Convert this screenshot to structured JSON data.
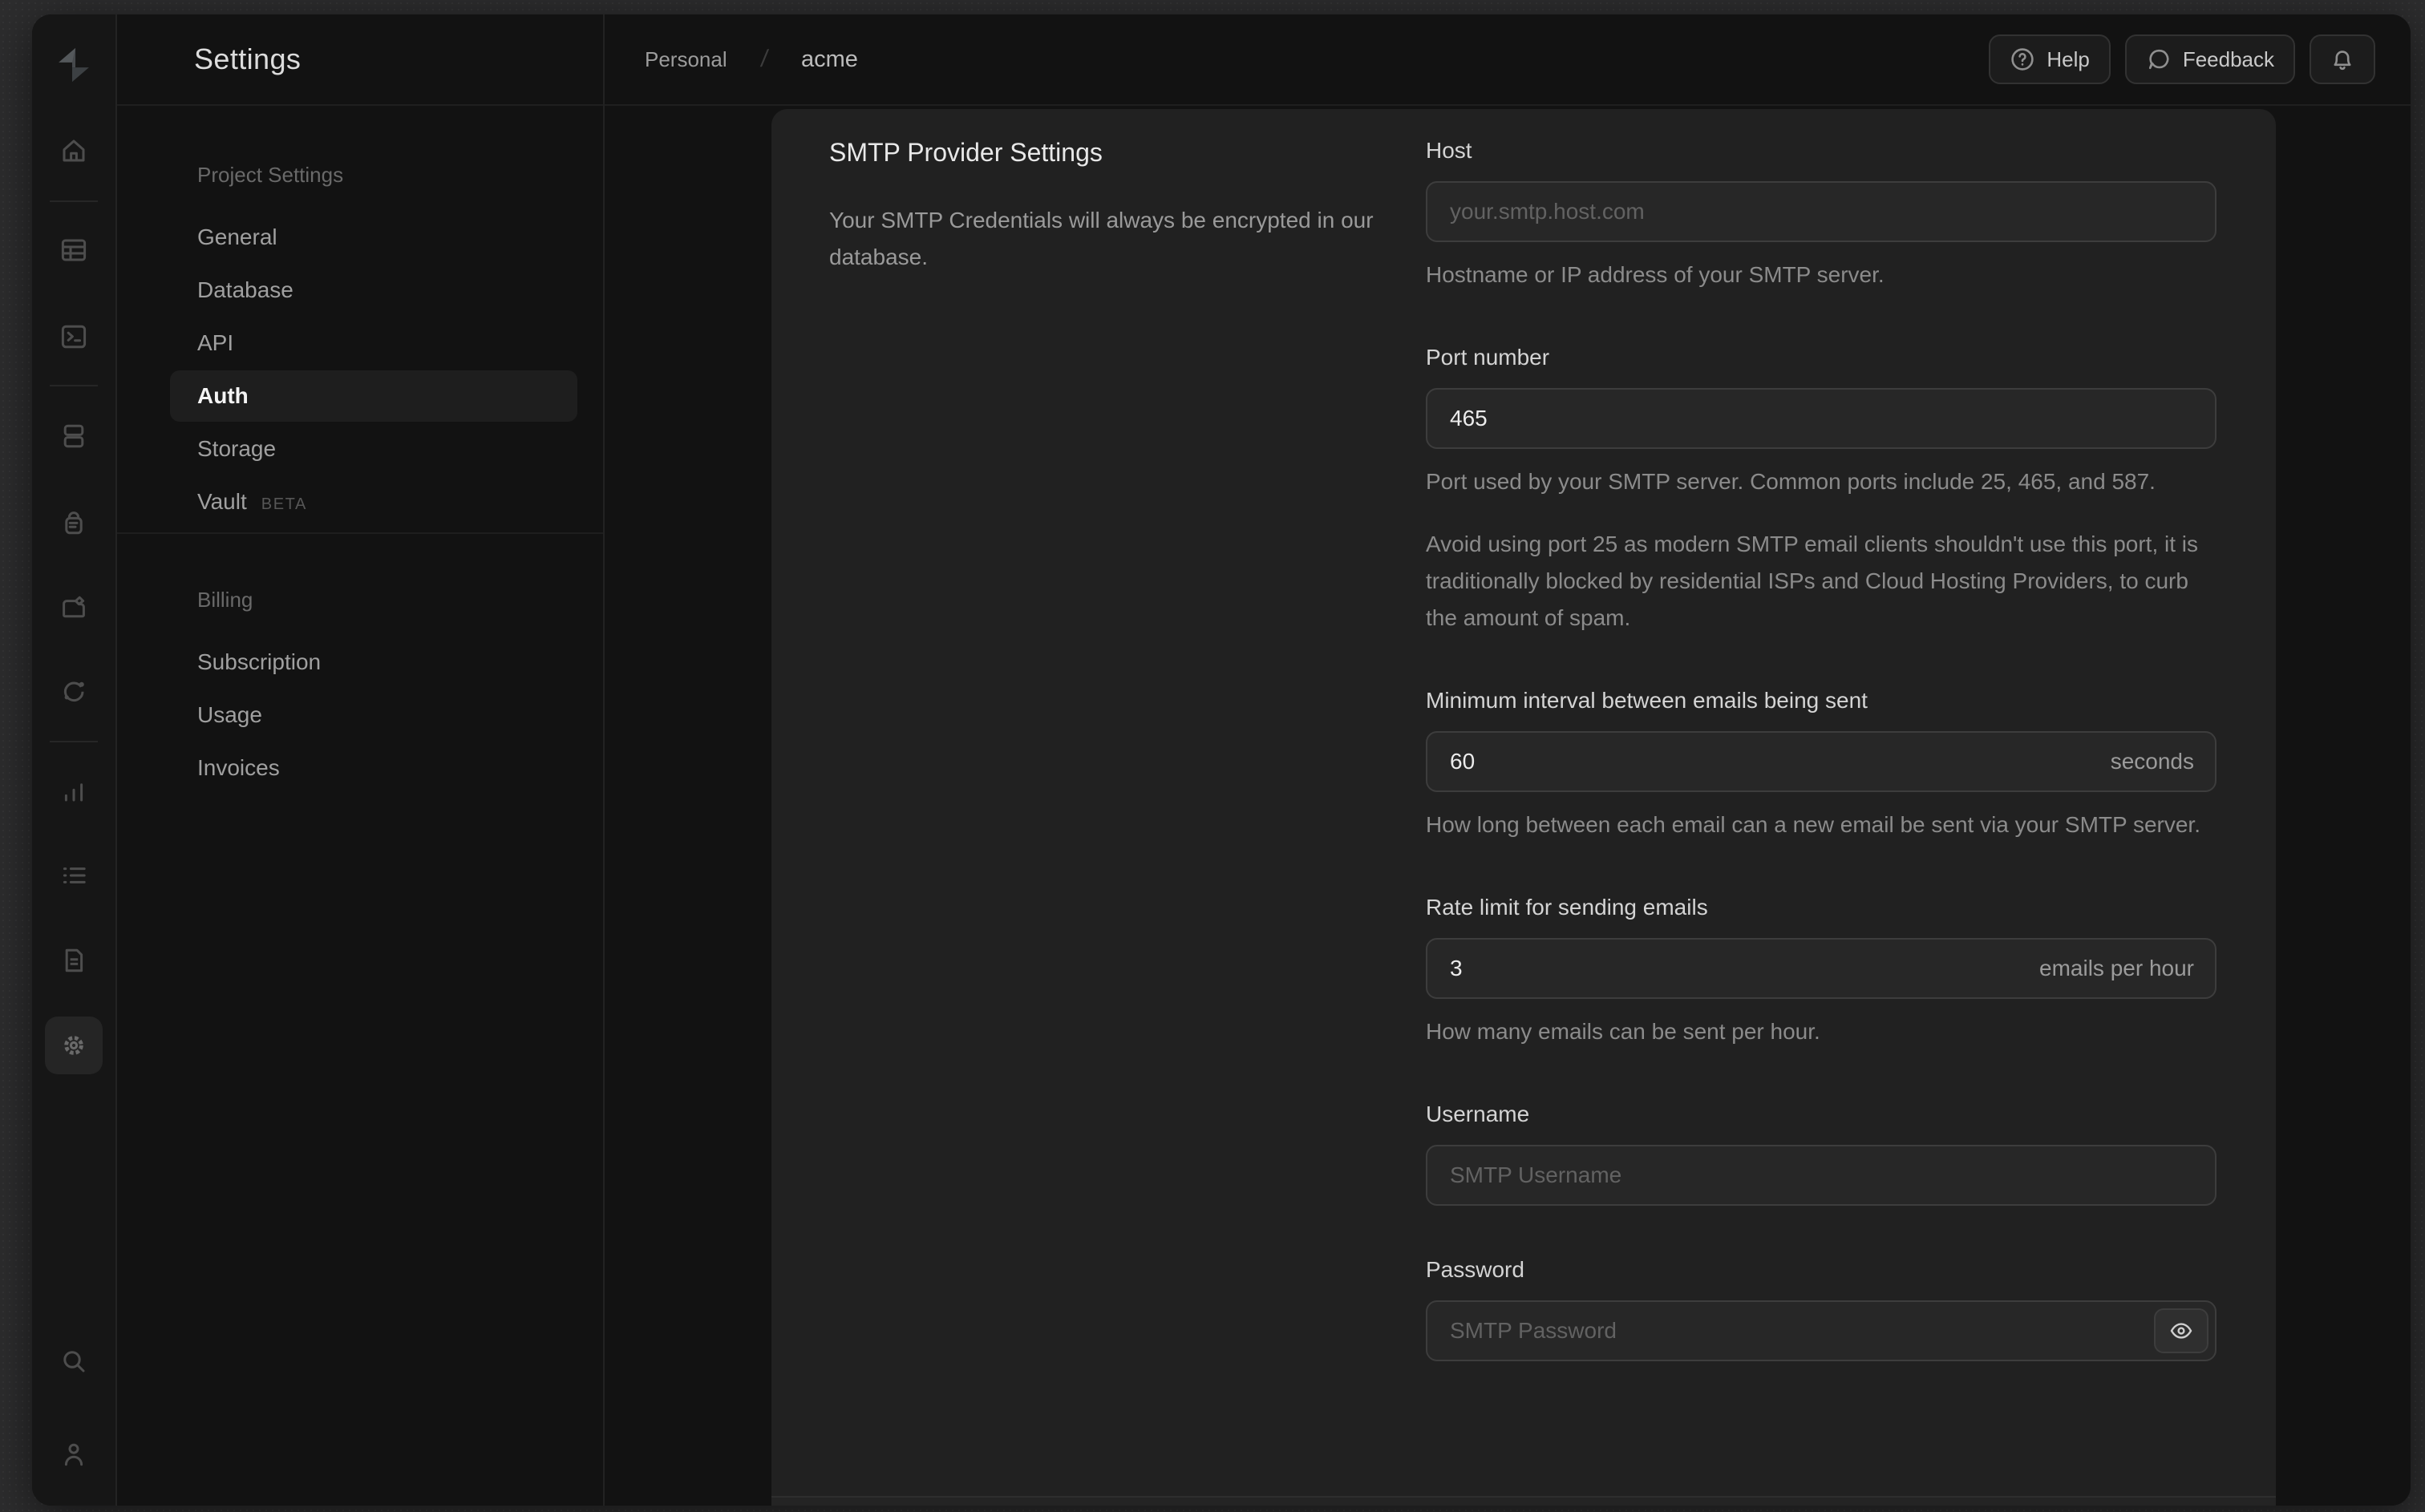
{
  "colors": {
    "desktop": "#2d2d2e",
    "window_bg": "#121212",
    "card_bg": "#212121",
    "input_bg": "#272727",
    "active_text": "#f4f4f4"
  },
  "rail_icons": [
    "supabase-logo",
    "home",
    "table-editor",
    "sql-editor",
    "database",
    "auth",
    "storage",
    "edge-functions",
    "reports",
    "logs",
    "api-docs",
    "settings",
    "search",
    "account"
  ],
  "sidebar": {
    "title": "Settings",
    "sections": [
      {
        "heading": "Project Settings",
        "items": [
          {
            "label": "General"
          },
          {
            "label": "Database"
          },
          {
            "label": "API"
          },
          {
            "label": "Auth",
            "active": true
          },
          {
            "label": "Storage"
          },
          {
            "label": "Vault",
            "badge": "BETA"
          }
        ]
      },
      {
        "heading": "Billing",
        "items": [
          {
            "label": "Subscription"
          },
          {
            "label": "Usage"
          },
          {
            "label": "Invoices"
          }
        ]
      }
    ]
  },
  "topbar": {
    "org": "Personal",
    "separator": "/",
    "project": "acme",
    "help_label": "Help",
    "feedback_label": "Feedback"
  },
  "panel": {
    "title": "SMTP Provider Settings",
    "description": "Your SMTP Credentials will always be encrypted in our database."
  },
  "fields": {
    "host": {
      "label": "Host",
      "placeholder": "your.smtp.host.com",
      "helper": "Hostname or IP address of your SMTP server."
    },
    "port": {
      "label": "Port number",
      "value": "465",
      "helper1": "Port used by your SMTP server. Common ports include 25, 465, and 587.",
      "helper2": "Avoid using port 25 as modern SMTP email clients shouldn't use this port, it is traditionally blocked by residential ISPs and Cloud Hosting Providers, to curb the amount of spam."
    },
    "interval": {
      "label": "Minimum interval between emails being sent",
      "value": "60",
      "unit": "seconds",
      "helper": "How long between each email can a new email be sent via your SMTP server."
    },
    "rate": {
      "label": "Rate limit for sending emails",
      "value": "3",
      "unit": "emails per hour",
      "helper": "How many emails can be sent per hour."
    },
    "username": {
      "label": "Username",
      "placeholder": "SMTP Username"
    },
    "password": {
      "label": "Password",
      "placeholder": "SMTP Password"
    }
  }
}
